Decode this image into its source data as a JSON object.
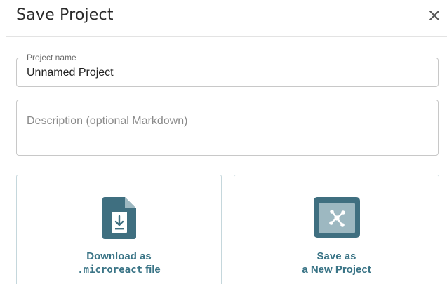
{
  "dialog": {
    "title": "Save Project",
    "close_icon": "close-icon"
  },
  "project_name": {
    "label": "Project name",
    "value": "Unnamed Project"
  },
  "description": {
    "placeholder": "Description (optional Markdown)",
    "value": ""
  },
  "options": {
    "download": {
      "line1": "Download as",
      "line2_code": ".microreact",
      "line2_text": " file",
      "icon": "download-file-icon"
    },
    "save_new": {
      "line1": "Save as",
      "line2": "a New Project",
      "icon": "new-project-icon"
    }
  },
  "colors": {
    "accent": "#3a7486",
    "icon_fill": "#3f6f80",
    "card_border": "#c5d7dc"
  }
}
